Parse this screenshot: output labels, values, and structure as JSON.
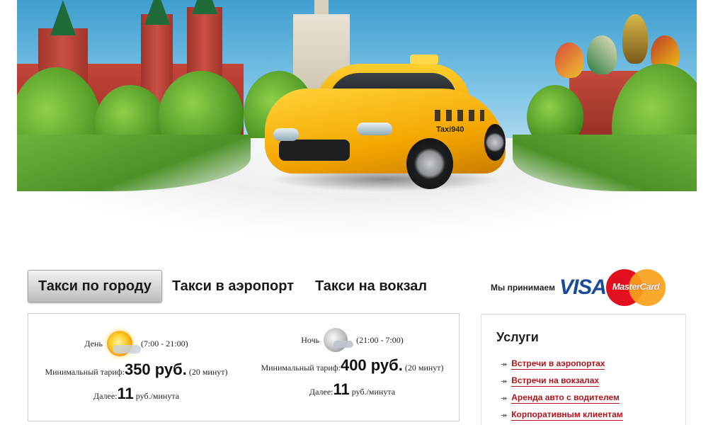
{
  "hero": {
    "car_plate_text": "Taxi940",
    "colors": {
      "sky": "#4fa6d6",
      "car_yellow": "#f5a700",
      "accent_orange": "#f08a1c"
    }
  },
  "tabs": [
    {
      "label": "Такси по городу",
      "active": true
    },
    {
      "label": "Такси в аэропорт",
      "active": false
    },
    {
      "label": "Такси на вокзал",
      "active": false
    }
  ],
  "payment": {
    "text": "Мы принимаем",
    "visa_label": "VISA",
    "mastercard_label": "MasterCard"
  },
  "tariffs": {
    "day": {
      "label": "День",
      "hours": "(7:00 - 21:00)",
      "min_label": "Минимальный тариф:",
      "min_price": "350 руб.",
      "min_duration": "(20 минут)",
      "next_label": "Далее:",
      "next_value": "11",
      "next_unit": "руб./минута",
      "icon": "sun-icon"
    },
    "night": {
      "label": "Ночь",
      "hours": "(21:00 - 7:00)",
      "min_label": "Минимальный тариф:",
      "min_price": "400 руб.",
      "min_duration": "(20 минут)",
      "next_label": "Далее:",
      "next_value": "11",
      "next_unit": "руб./минута",
      "icon": "moon-icon"
    }
  },
  "services": {
    "title": "Услуги",
    "items": [
      "Встречи в аэропортах",
      "Встречи на вокзалах",
      "Аренда авто с водителем",
      "Корпоративным клиентам"
    ],
    "link_color": "#b0141c"
  }
}
